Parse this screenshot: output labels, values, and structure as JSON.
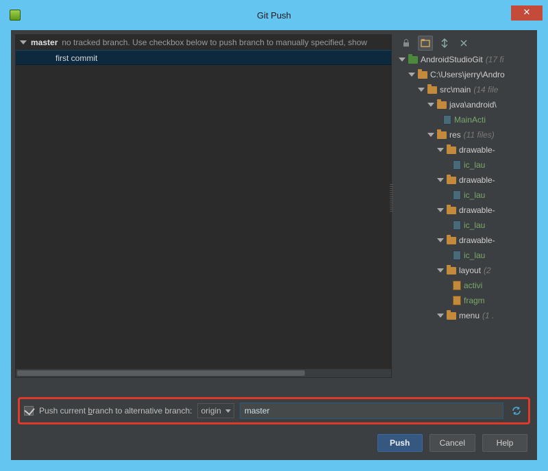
{
  "window": {
    "title": "Git Push"
  },
  "left": {
    "branch": "master",
    "note": "no tracked branch. Use checkbox below to push branch to manually specified, show",
    "commit": "first commit"
  },
  "tree": [
    {
      "depth": 0,
      "kind": "folder-green",
      "label": "AndroidStudioGit",
      "meta": "(17 fi",
      "expand": true
    },
    {
      "depth": 1,
      "kind": "folder",
      "label": "C:\\Users\\jerry\\Andro",
      "meta": "",
      "expand": true
    },
    {
      "depth": 2,
      "kind": "folder",
      "label": "src\\main",
      "meta": "(14 file",
      "expand": true
    },
    {
      "depth": 3,
      "kind": "folder",
      "label": "java\\android\\",
      "meta": "",
      "expand": true
    },
    {
      "depth": 4,
      "kind": "file",
      "label": "MainActi",
      "green": true
    },
    {
      "depth": 3,
      "kind": "folder",
      "label": "res",
      "meta": "(11 files)",
      "expand": true
    },
    {
      "depth": 4,
      "kind": "folder",
      "label": "drawable-",
      "expand": true
    },
    {
      "depth": 5,
      "kind": "file",
      "label": "ic_lau",
      "green": true
    },
    {
      "depth": 4,
      "kind": "folder",
      "label": "drawable-",
      "expand": true
    },
    {
      "depth": 5,
      "kind": "file",
      "label": "ic_lau",
      "green": true
    },
    {
      "depth": 4,
      "kind": "folder",
      "label": "drawable-",
      "expand": true
    },
    {
      "depth": 5,
      "kind": "file",
      "label": "ic_lau",
      "green": true
    },
    {
      "depth": 4,
      "kind": "folder",
      "label": "drawable-",
      "expand": true
    },
    {
      "depth": 5,
      "kind": "file",
      "label": "ic_lau",
      "green": true
    },
    {
      "depth": 4,
      "kind": "folder",
      "label": "layout",
      "meta": "(2",
      "expand": true
    },
    {
      "depth": 5,
      "kind": "file-xml",
      "label": "activi",
      "green": true
    },
    {
      "depth": 5,
      "kind": "file-xml",
      "label": "fragm",
      "green": true
    },
    {
      "depth": 4,
      "kind": "folder",
      "label": "menu",
      "meta": "(1 .",
      "expand": true
    }
  ],
  "alt": {
    "label_pre": "Push current ",
    "label_u": "b",
    "label_post": "ranch to alternative branch:",
    "remote": "origin",
    "branch": "master"
  },
  "buttons": {
    "push": "Push",
    "cancel": "Cancel",
    "help": "Help"
  }
}
